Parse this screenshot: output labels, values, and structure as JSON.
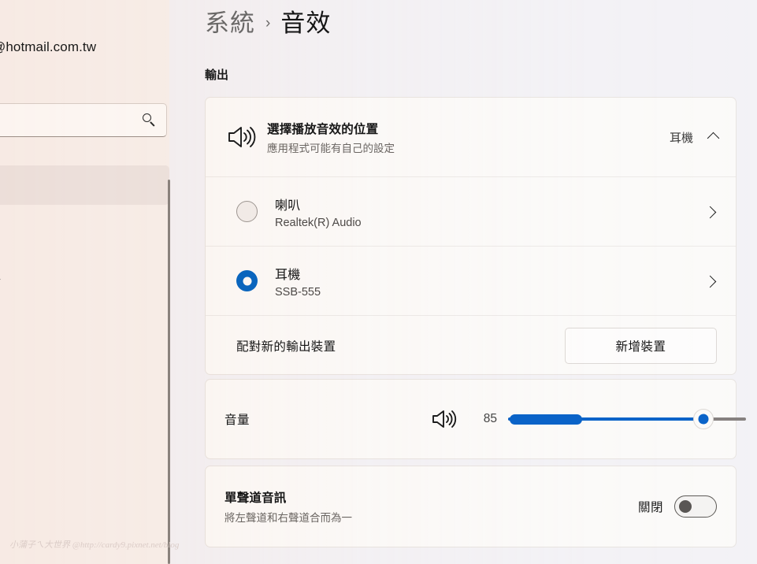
{
  "sidebar": {
    "account_email": "@hotmail.com.tw",
    "search": {
      "value": "",
      "placeholder": "",
      "icon": "search-icon"
    },
    "items": [
      {
        "label": "",
        "selected": true
      },
      {
        "label": "絡",
        "selected": false
      }
    ]
  },
  "content": {
    "breadcrumb": {
      "parent": "系統",
      "separator": "›",
      "current": "音效"
    },
    "section_output_label": "輸出",
    "output_device_row": {
      "icon": "speaker-icon",
      "title": "選擇播放音效的位置",
      "subtitle": "應用程式可能有自己的設定",
      "value": "耳機",
      "expand_icon": "chevron-up-icon"
    },
    "devices": [
      {
        "name": "喇叭",
        "description": "Realtek(R) Audio",
        "selected": false,
        "chevron": "chevron-right-icon"
      },
      {
        "name": "耳機",
        "description": "SSB-555",
        "selected": true,
        "chevron": "chevron-right-icon"
      }
    ],
    "pair_row": {
      "label": "配對新的輸出裝置",
      "button_label": "新增裝置"
    },
    "volume_row": {
      "label": "音量",
      "icon": "speaker-icon",
      "value": "85",
      "slider_percent": 85,
      "meter_percent": 30
    },
    "mono_row": {
      "title": "單聲道音訊",
      "subtitle": "將左聲道和右聲道合而為一",
      "state_label": "關閉",
      "toggle_on": false
    }
  },
  "watermark": "小蒲子ㄟ大世界 @http://cardy9.pixnet.net/blog",
  "colors": {
    "accent": "#0a63c9",
    "accent_radio": "#0a66c2",
    "page_background": "#f3f2f6",
    "card_background": "#fbfaf9",
    "sidebar_background": "#f7f1ee",
    "slider_track": "#868180"
  }
}
